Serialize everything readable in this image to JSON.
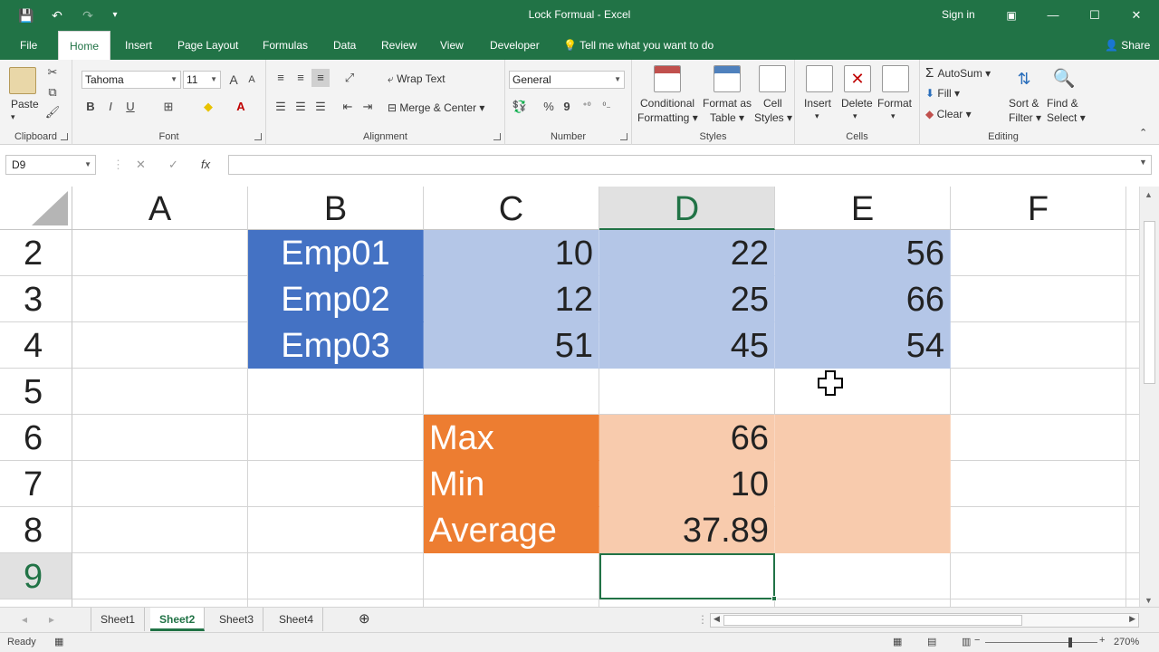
{
  "window": {
    "title": "Lock Formual - Excel",
    "signin": "Sign in",
    "minimize": "—",
    "restore": "☐",
    "close": "✕"
  },
  "qat": {
    "save": "💾",
    "undo": "↶",
    "redo": "↷",
    "customize": "▾"
  },
  "ribbon_tabs": [
    "File",
    "Home",
    "Insert",
    "Page Layout",
    "Formulas",
    "Data",
    "Review",
    "View",
    "Developer"
  ],
  "tell_me": "Tell me what you want to do",
  "share": "Share",
  "ribbon": {
    "clipboard": {
      "label": "Clipboard",
      "paste": "Paste"
    },
    "font": {
      "label": "Font",
      "family": "Tahoma",
      "size": "11",
      "bold": "B",
      "italic": "I",
      "underline": "U",
      "grow": "A",
      "shrink": "A"
    },
    "alignment": {
      "label": "Alignment",
      "wrap": "Wrap Text",
      "merge": "Merge & Center"
    },
    "number": {
      "label": "Number",
      "format": "General",
      "percent": "%",
      "comma": "9"
    },
    "styles": {
      "label": "Styles",
      "cond1": "Conditional",
      "cond2": "Formatting",
      "fmt1": "Format as",
      "fmt2": "Table",
      "cell1": "Cell",
      "cell2": "Styles"
    },
    "cells": {
      "label": "Cells",
      "insert": "Insert",
      "delete": "Delete",
      "format": "Format"
    },
    "editing": {
      "label": "Editing",
      "autosum": "AutoSum",
      "fill": "Fill",
      "clear": "Clear",
      "sort1": "Sort &",
      "sort2": "Filter",
      "find1": "Find &",
      "find2": "Select"
    }
  },
  "formula_bar": {
    "name_box": "D9",
    "cancel": "✕",
    "enter": "✓",
    "fx": "fx",
    "formula": ""
  },
  "grid": {
    "columns": [
      "A",
      "B",
      "C",
      "D",
      "E",
      "F"
    ],
    "selected_column": "D",
    "rows": [
      "2",
      "3",
      "4",
      "5",
      "6",
      "7",
      "8",
      "9"
    ],
    "selected_row": "9",
    "cells": {
      "B2": "Emp01",
      "C2": "10",
      "D2": "22",
      "E2": "56",
      "B3": "Emp02",
      "C3": "12",
      "D3": "25",
      "E3": "66",
      "B4": "Emp03",
      "C4": "51",
      "D4": "45",
      "E4": "54",
      "C6": "Max",
      "D6": "66",
      "C7": "Min",
      "D7": "10",
      "C8": "Average",
      "D8": "37.89"
    },
    "colors": {
      "employee_fill": "#4472c4",
      "data_fill": "#b4c6e7",
      "stat_label_fill": "#ed7d31",
      "stat_value_fill": "#f8cbad",
      "accent": "#217346"
    }
  },
  "sheets": [
    "Sheet1",
    "Sheet2",
    "Sheet3",
    "Sheet4"
  ],
  "active_sheet": "Sheet2",
  "status": {
    "ready": "Ready",
    "zoom": "270%",
    "minus": "−",
    "plus": "+"
  }
}
